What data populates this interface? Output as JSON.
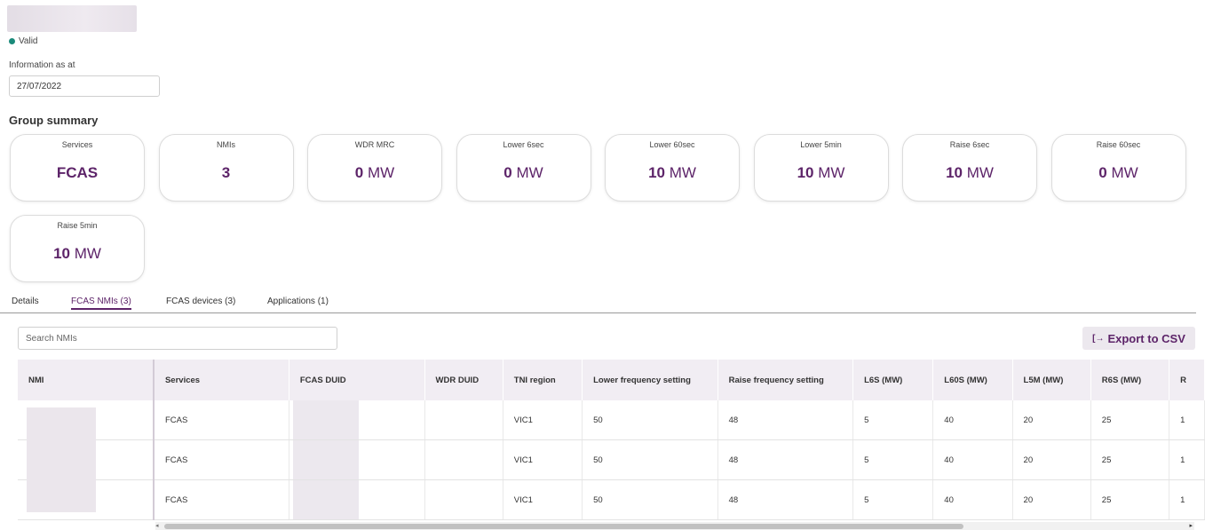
{
  "status": {
    "label": "Valid",
    "color": "#1a8a7a"
  },
  "info": {
    "label": "Information as at",
    "date": "27/07/2022"
  },
  "group_summary": {
    "title": "Group summary",
    "cards": [
      {
        "label": "Services",
        "value": "FCAS",
        "unit": ""
      },
      {
        "label": "NMIs",
        "value": "3",
        "unit": ""
      },
      {
        "label": "WDR MRC",
        "value": "0",
        "unit": "MW"
      },
      {
        "label": "Lower 6sec",
        "value": "0",
        "unit": "MW"
      },
      {
        "label": "Lower 60sec",
        "value": "10",
        "unit": "MW"
      },
      {
        "label": "Lower 5min",
        "value": "10",
        "unit": "MW"
      },
      {
        "label": "Raise 6sec",
        "value": "10",
        "unit": "MW"
      },
      {
        "label": "Raise 60sec",
        "value": "0",
        "unit": "MW"
      },
      {
        "label": "Raise 5min",
        "value": "10",
        "unit": "MW"
      }
    ]
  },
  "tabs": [
    {
      "label": "Details",
      "active": false
    },
    {
      "label": "FCAS NMIs (3)",
      "active": true
    },
    {
      "label": "FCAS devices (3)",
      "active": false
    },
    {
      "label": "Applications (1)",
      "active": false
    }
  ],
  "search": {
    "placeholder": "Search NMIs"
  },
  "export": {
    "label": "Export to CSV",
    "icon": "export-icon"
  },
  "table": {
    "headers": [
      "NMI",
      "Services",
      "FCAS DUID",
      "WDR DUID",
      "TNI region",
      "Lower frequency setting",
      "Raise frequency setting",
      "L6S (MW)",
      "L60S (MW)",
      "L5M (MW)",
      "R6S (MW)",
      "R"
    ],
    "rows": [
      [
        "",
        "FCAS",
        "",
        "",
        "VIC1",
        "50",
        "48",
        "5",
        "40",
        "20",
        "25",
        "1"
      ],
      [
        "",
        "FCAS",
        "",
        "",
        "VIC1",
        "50",
        "48",
        "5",
        "40",
        "20",
        "25",
        "1"
      ],
      [
        "",
        "FCAS",
        "",
        "",
        "VIC1",
        "50",
        "48",
        "5",
        "40",
        "20",
        "25",
        "1"
      ]
    ]
  },
  "colors": {
    "accent": "#5d2469",
    "header_bg": "#f1edf3",
    "button_bg": "#ece8ee"
  }
}
